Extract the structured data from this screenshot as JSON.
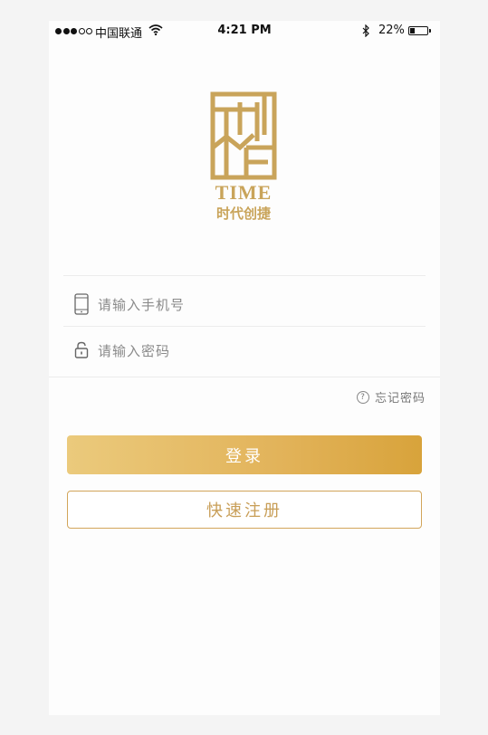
{
  "status_bar": {
    "carrier": "中国联通",
    "time": "4:21 PM",
    "battery_percent": "22%",
    "battery_level": 0.22
  },
  "logo": {
    "wordmark": "TIME",
    "subtitle": "时代创捷",
    "color": "#c9a45a"
  },
  "login_form": {
    "phone_placeholder": "请输入手机号",
    "password_placeholder": "请输入密码",
    "forgot_password": "忘记密码",
    "help_icon_glyph": "?"
  },
  "buttons": {
    "login_label": "登录",
    "register_label": "快速注册"
  },
  "colors": {
    "accent_gold": "#d8a33b",
    "gradient_start": "#ebca7c",
    "register_border": "#d2a55a"
  }
}
